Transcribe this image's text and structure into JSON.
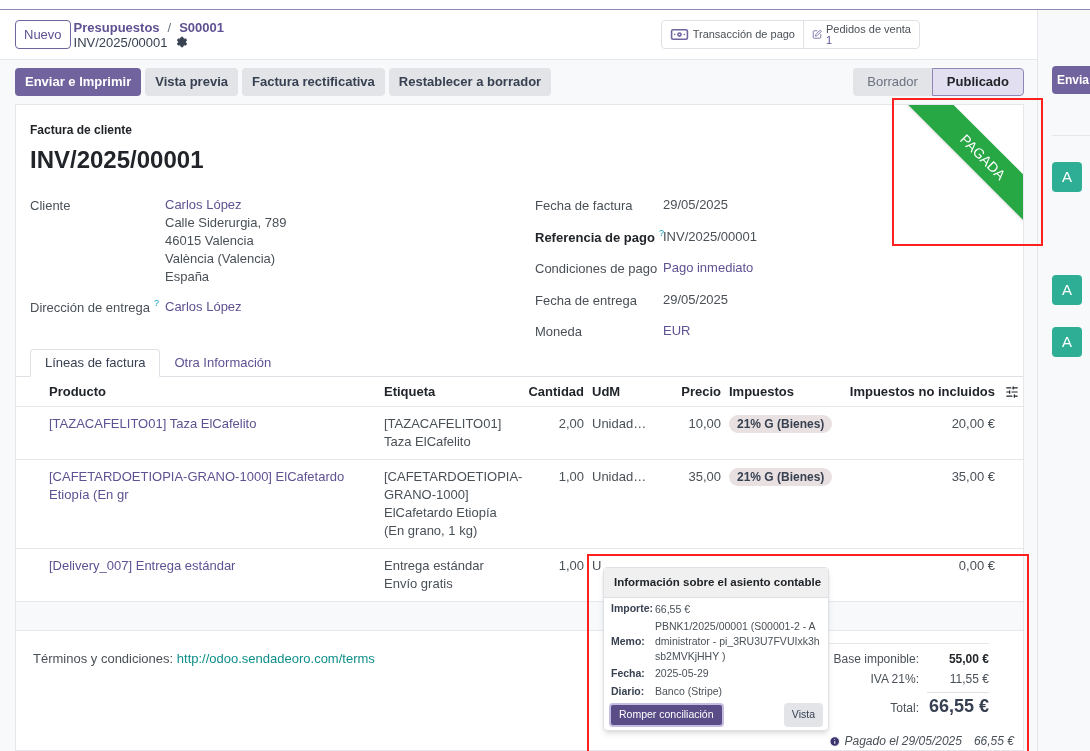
{
  "breadcrumb": {
    "new_button": "Nuevo",
    "path": [
      "Presupuestos",
      "S00001"
    ],
    "separator": "/",
    "record": "INV/2025/00001"
  },
  "smart_buttons": [
    {
      "kind": "payment",
      "label": "Transacción de pago"
    },
    {
      "kind": "orders",
      "label": "Pedidos de venta",
      "count": "1"
    }
  ],
  "actions": [
    {
      "label": "Enviar e Imprimir",
      "primary": true
    },
    {
      "label": "Vista previa",
      "primary": false
    },
    {
      "label": "Factura rectificativa",
      "primary": false
    },
    {
      "label": "Restablecer a borrador",
      "primary": false
    }
  ],
  "status": [
    {
      "label": "Borrador",
      "selected": false
    },
    {
      "label": "Publicado",
      "selected": true
    }
  ],
  "chatter": {
    "send_button": "Envia",
    "avatars": [
      "A",
      "A",
      "A"
    ]
  },
  "invoice": {
    "type": "Factura de cliente",
    "number": "INV/2025/00001",
    "ribbon": {
      "text": "PAGADA",
      "highlighted": true
    },
    "left_fields": [
      {
        "label": "Cliente",
        "value": "Carlos López",
        "link": true,
        "bold": false,
        "address": [
          "Calle Siderurgia, 789",
          "46015 Valencia",
          "València (Valencia)",
          "España"
        ]
      },
      {
        "label": "Dirección de entrega",
        "help": "?",
        "value": "Carlos López",
        "link": true,
        "bold": false
      }
    ],
    "right_fields": [
      {
        "label": "Fecha de factura",
        "value": "29/05/2025",
        "link": false,
        "bold": false
      },
      {
        "label": "Referencia de pago",
        "help": "?",
        "value": "INV/2025/00001",
        "link": false,
        "bold": true
      },
      {
        "label": "Condiciones de pago",
        "value": "Pago inmediato",
        "link": true,
        "bold": false
      },
      {
        "label": "Fecha de entrega",
        "value": "29/05/2025",
        "link": false,
        "bold": false
      },
      {
        "label": "Moneda",
        "value": "EUR",
        "link": true,
        "bold": false
      }
    ]
  },
  "tabs": [
    {
      "label": "Líneas de factura",
      "selected": true
    },
    {
      "label": "Otra Información",
      "selected": false
    }
  ],
  "table": {
    "columns": [
      "Producto",
      "Etiqueta",
      "Cantidad",
      "UdM",
      "Precio",
      "Impuestos",
      "Impuestos no incluidos"
    ],
    "rows": [
      {
        "product": "[TAZACAFELITO01] Taza ElCafelito",
        "label": [
          "[TAZACAFELITO01]",
          "Taza ElCafelito"
        ],
        "quantity": "2,00",
        "uom": "Unidad…",
        "price": "10,00",
        "tax": "21% G (Bienes)",
        "subtotal": "20,00 €"
      },
      {
        "product": "[CAFETARDOETIOPIA-GRANO-1000] ElCafetardo Etiopía (En gr",
        "label": [
          "[CAFETARDOETIOPIA-",
          "GRANO-1000]",
          "ElCafetardo Etiopía",
          "(En grano, 1 kg)"
        ],
        "quantity": "1,00",
        "uom": "Unidad…",
        "price": "35,00",
        "tax": "21% G (Bienes)",
        "subtotal": "35,00 €"
      },
      {
        "product": "[Delivery_007] Entrega estándar",
        "label": [
          "Entrega estándar",
          "Envío gratis"
        ],
        "quantity": "1,00",
        "uom": "U",
        "subtotal": "0,00 €"
      }
    ]
  },
  "terms": {
    "label": "Términos y condiciones:",
    "link": "http://odoo.sendadeoro.com/terms"
  },
  "totals": [
    {
      "kind": "subtotal",
      "label": "Base imponible:",
      "value": "55,00 €"
    },
    {
      "kind": "tax",
      "label": "IVA 21%:",
      "value": "11,55 €"
    },
    {
      "kind": "total",
      "label": "Total:",
      "value": "66,55 €"
    }
  ],
  "payments": [
    {
      "text": "Pagado el 29/05/2025",
      "amount": "66,55 €"
    }
  ],
  "popover": {
    "title": "Información sobre el asiento contable",
    "highlighted": true,
    "fields": [
      {
        "label": "Importe:",
        "value": "66,55 €"
      },
      {
        "label": "Memo:",
        "value": "PBNK1/2025/00001 (S00001-2 - Administrator - pi_3RU3U7FVUIxk3hsb2MVKjHHY )"
      },
      {
        "label": "Fecha:",
        "value": "2025-05-29"
      },
      {
        "label": "Diario:",
        "value": "Banco (Stripe)"
      }
    ],
    "buttons": [
      {
        "label": "Romper conciliación",
        "primary": true
      },
      {
        "label": "Vista",
        "primary": false
      }
    ]
  }
}
